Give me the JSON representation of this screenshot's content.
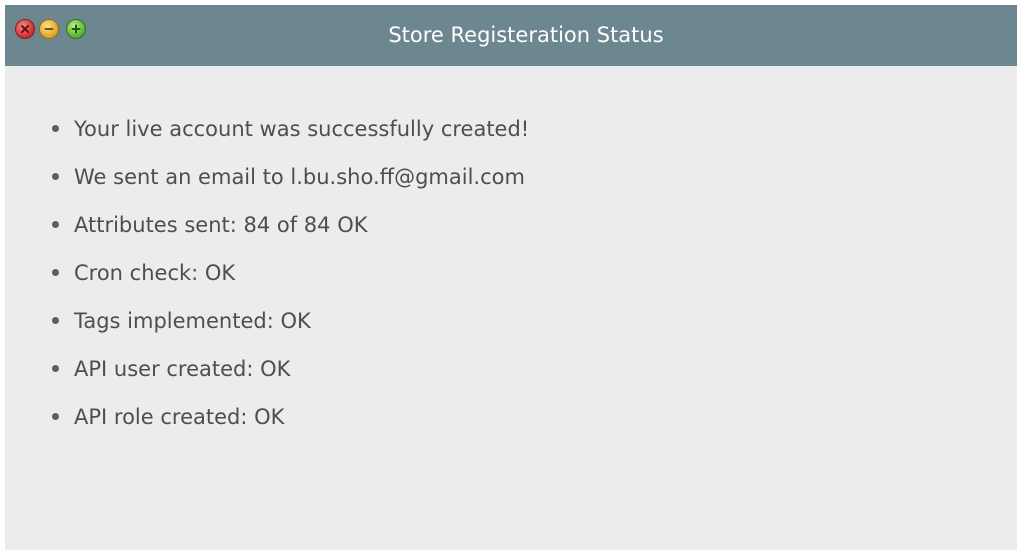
{
  "window": {
    "title": "Store Registeration Status",
    "controls": {
      "close_icon": "close-icon",
      "minimize_icon": "minimize-icon",
      "maximize_icon": "maximize-icon"
    },
    "colors": {
      "titlebar": "#6d8791",
      "background": "#ececec",
      "text": "#4e4e4e"
    }
  },
  "status": {
    "items": [
      {
        "text": "Your live account was successfully created!"
      },
      {
        "text": "We sent an email to l.bu.sho.ff@gmail.com"
      },
      {
        "text": "Attributes sent: 84 of 84 OK"
      },
      {
        "text": "Cron check: OK"
      },
      {
        "text": "Tags implemented: OK"
      },
      {
        "text": "API user created: OK"
      },
      {
        "text": "API role created: OK"
      }
    ]
  }
}
